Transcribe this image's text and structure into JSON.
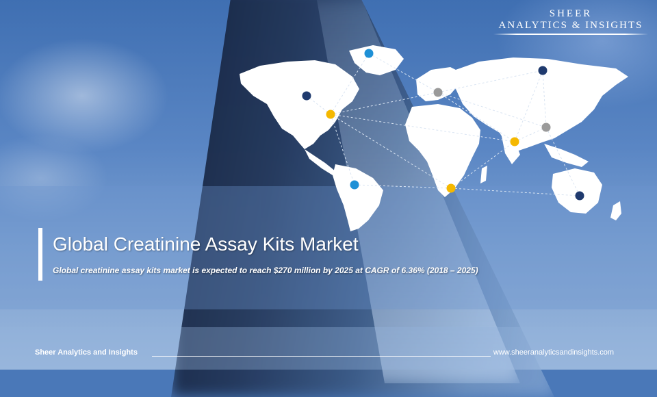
{
  "brand": {
    "line1": "SHEER",
    "line2": "ANALYTICS & INSIGHTS"
  },
  "slide": {
    "title": "Global Creatinine Assay Kits Market",
    "subtitle": "Global creatinine assay  kits market is expected to reach $270 million by 2025 at CAGR of 6.36% (2018 – 2025)"
  },
  "footer": {
    "company": "Sheer Analytics and Insights",
    "website": "www.sheeranalyticsandinsights.com"
  },
  "map": {
    "marker_colors": {
      "navy": "#1f3a6e",
      "gold": "#f5b800",
      "sky": "#1e90d6",
      "gray": "#9a9a9a"
    }
  }
}
